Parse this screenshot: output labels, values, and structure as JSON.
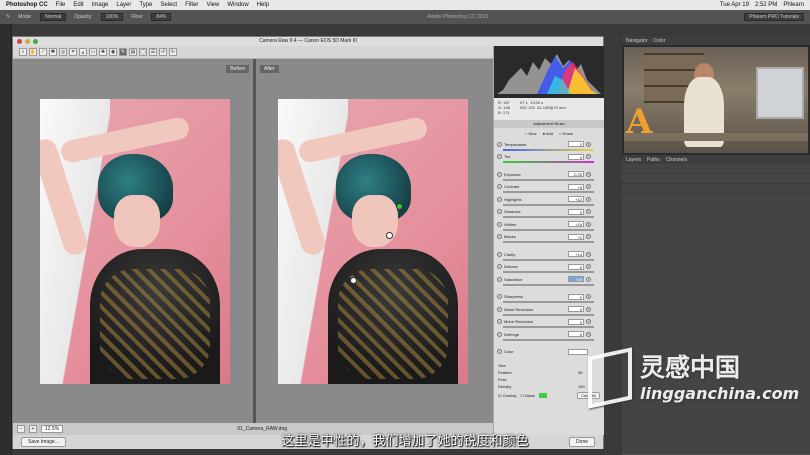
{
  "menubar": {
    "app": "Photoshop CC",
    "items": [
      "File",
      "Edit",
      "Image",
      "Layer",
      "Type",
      "Select",
      "Filter",
      "View",
      "Window",
      "Help"
    ],
    "right": [
      "Tue Apr 19",
      "2:52 PM",
      "Phlearn"
    ]
  },
  "ps": {
    "title": "Adobe Photoshop CC 2015",
    "options": {
      "mode_label": "Mode:",
      "mode_value": "Normal",
      "opacity_label": "Opacity:",
      "opacity_value": "100%",
      "flow_label": "Flow:",
      "flow_value": "84%"
    },
    "right_tag": "Phlearn PRO Tutorials"
  },
  "camera_raw": {
    "title": "Camera Raw 9.4 — Canon EOS 5D Mark III",
    "before_label": "Before",
    "after_label": "After",
    "zoom": "12.5%",
    "filename": "01_Camera_RAW.dng",
    "save_button": "Save Image...",
    "done_button": "Done",
    "readout": {
      "r": "R: 187",
      "g": "G: 146",
      "b": "B: 171",
      "aperture": "f/7.1",
      "shutter": "1/100 s",
      "iso": "ISO 125",
      "lens": "24-105@70 mm"
    },
    "section_title": "Adjustment Brush",
    "modes": [
      "New",
      "Add",
      "Erase"
    ],
    "sliders": [
      {
        "label": "Temperature",
        "value": "0"
      },
      {
        "label": "Tint",
        "value": "0"
      },
      {
        "label": "Exposure",
        "value": "-0.25"
      },
      {
        "label": "Contrast",
        "value": "+8"
      },
      {
        "label": "Highlights",
        "value": "+12"
      },
      {
        "label": "Shadows",
        "value": "0"
      },
      {
        "label": "Whites",
        "value": "+19"
      },
      {
        "label": "Blacks",
        "value": "+2"
      },
      {
        "label": "Clarity",
        "value": "+14"
      },
      {
        "label": "Dehaze",
        "value": "0"
      },
      {
        "label": "Saturation",
        "value": "+20"
      },
      {
        "label": "Sharpness",
        "value": "0"
      },
      {
        "label": "Noise Reduction",
        "value": "0"
      },
      {
        "label": "Moire Reduction",
        "value": "0"
      },
      {
        "label": "Defringe",
        "value": "0"
      }
    ],
    "color_label": "Color",
    "brush": {
      "size_label": "Size",
      "size_value": "",
      "feather_label": "Feather",
      "feather_value": "36",
      "flow_label": "Flow",
      "flow_value": "",
      "density_label": "Density",
      "density_value": "100"
    },
    "overlay_label": "Overlay",
    "mask_label": "Mask",
    "clear_all": "Clear All"
  },
  "right_panels": {
    "tabs_top": [
      "Navigator",
      "Color"
    ],
    "tabs_layers": [
      "Layers",
      "Paths",
      "Channels"
    ]
  },
  "subtitle": "这里是中性的，我们增加了她的锐度和颜色",
  "watermark": {
    "cn": "灵感中国",
    "en": "lingganchina.com"
  }
}
